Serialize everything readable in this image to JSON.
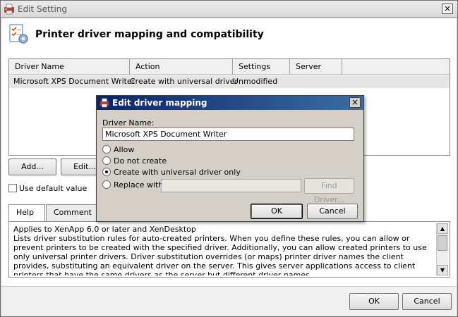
{
  "window": {
    "title": "Edit Setting",
    "close_glyph": "×"
  },
  "header": {
    "title": "Printer driver mapping and compatibility"
  },
  "table": {
    "columns": [
      "Driver Name",
      "Action",
      "Settings",
      "Server Driver"
    ],
    "rows": [
      {
        "driver_name": "Microsoft XPS Document Writer",
        "action": "Create with universal driver",
        "settings": "Unmodified",
        "server_driver": ""
      }
    ]
  },
  "buttons": {
    "add": "Add...",
    "edit": "Edit...",
    "ok": "OK",
    "cancel": "Cancel"
  },
  "use_default": {
    "label": "Use default value",
    "checked": false
  },
  "tabs": [
    {
      "label": "Help",
      "active": true
    },
    {
      "label": "Comment",
      "active": false
    }
  ],
  "help_text": "Applies to XenApp 6.0 or later and XenDesktop\nLists driver substitution rules for auto-created printers. When you define these rules, you can allow or prevent printers to be created with the specified driver. Additionally, you can allow created printers to use only universal printer drivers. Driver substitution overrides (or maps) printer driver names the client provides, substituting an equivalent driver on the server. This gives server applications access to client printers that have the same drivers as the server but different driver names.",
  "dialog": {
    "title": "Edit driver mapping",
    "close_glyph": "×",
    "driver_name_label": "Driver Name:",
    "driver_name_value": "Microsoft XPS Document Writer",
    "options": [
      {
        "label": "Allow",
        "selected": false
      },
      {
        "label": "Do not create",
        "selected": false
      },
      {
        "label": "Create with universal driver only",
        "selected": true
      },
      {
        "label": "Replace with",
        "selected": false
      }
    ],
    "replace_value": "",
    "find_driver": "Find Driver...",
    "ok": "OK",
    "cancel": "Cancel"
  },
  "icons": {
    "window": "printer-icon",
    "header": "settings-checklist-icon"
  },
  "colors": {
    "dialog_title_start": "#0a246a",
    "dialog_title_end": "#3a6ea5",
    "selected_row": "#e6e6e6"
  }
}
